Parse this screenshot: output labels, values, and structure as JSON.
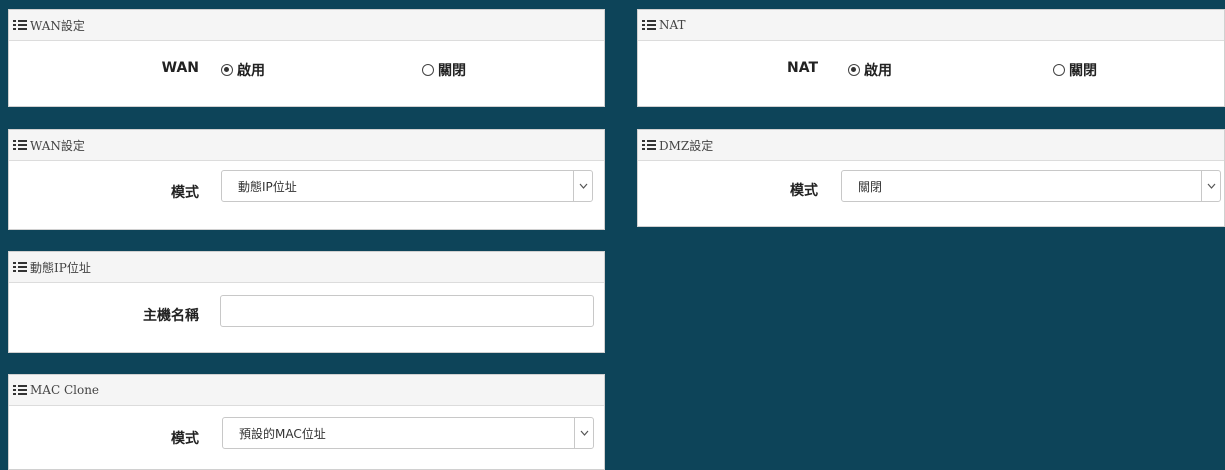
{
  "panels": {
    "wan_toggle": {
      "header": "WAN設定",
      "label": "WAN",
      "options": [
        {
          "label": "啟用",
          "checked": true
        },
        {
          "label": "關閉",
          "checked": false
        }
      ]
    },
    "nat_toggle": {
      "header": "NAT",
      "label": "NAT",
      "options": [
        {
          "label": "啟用",
          "checked": true
        },
        {
          "label": "關閉",
          "checked": false
        }
      ]
    },
    "wan_mode": {
      "header": "WAN設定",
      "label": "模式",
      "selected": "動態IP位址"
    },
    "dmz": {
      "header": "DMZ設定",
      "label": "模式",
      "selected": "關閉"
    },
    "dhcp": {
      "header": "動態IP位址",
      "label": "主機名稱",
      "value": ""
    },
    "mac_clone": {
      "header": "MAC Clone",
      "label": "模式",
      "selected": "預設的MAC位址"
    }
  },
  "icons": {
    "header_icon": "list-icon",
    "select_arrow": "chevron-down-icon"
  },
  "colors": {
    "background": "#0d4459",
    "panel": "#ffffff",
    "header": "#f5f5f5"
  }
}
